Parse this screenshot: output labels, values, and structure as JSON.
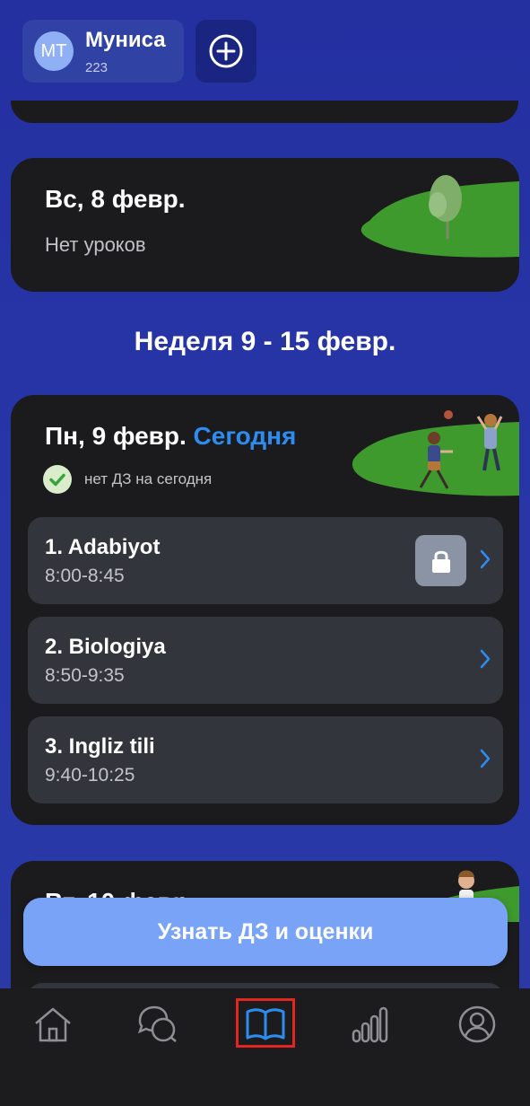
{
  "profile": {
    "initials": "МТ",
    "name": "Муниса",
    "subtitle": "223"
  },
  "days": [
    {
      "title": "Вс, 8 февр.",
      "note": "Нет уроков"
    }
  ],
  "week": {
    "title": "Неделя  9 - 15 февр."
  },
  "today_card": {
    "title": "Пн, 9 февр.",
    "today_label": "Сегодня",
    "homework_status": "нет ДЗ на сегодня",
    "lessons": [
      {
        "name": "1. Adabiyot",
        "time": "8:00-8:45",
        "locked": true
      },
      {
        "name": "2. Biologiya",
        "time": "8:50-9:35",
        "locked": false
      },
      {
        "name": "3. Ingliz tili",
        "time": "9:40-10:25",
        "locked": false
      }
    ]
  },
  "next_card": {
    "title": "Вт, 10 февр."
  },
  "cta": {
    "label": "Узнать ДЗ и оценки"
  },
  "tabs": [
    {
      "icon": "home-icon"
    },
    {
      "icon": "chat-icon"
    },
    {
      "icon": "book-icon",
      "active": true
    },
    {
      "icon": "stats-icon"
    },
    {
      "icon": "profile-icon"
    }
  ],
  "colors": {
    "accent": "#2d8cf0",
    "cta": "#79a3f6",
    "card": "#1b1b1d",
    "lesson": "#33353c",
    "grass": "#3f9a2e"
  }
}
